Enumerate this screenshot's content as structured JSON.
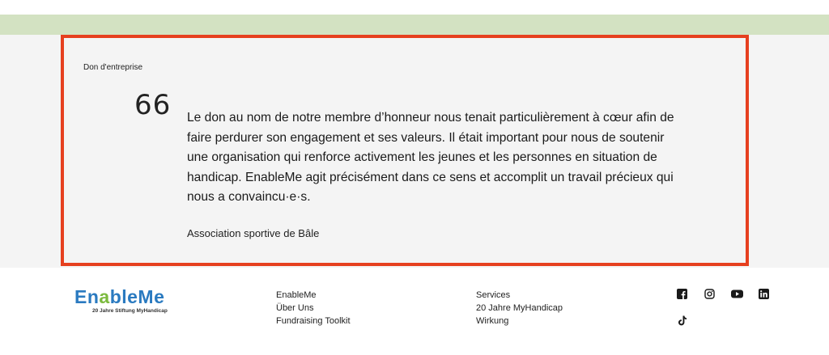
{
  "testimonial": {
    "category": "Don d'entreprise",
    "quote_mark": "66",
    "text": "Le don au nom de notre membre d’honneur nous tenait particulièrement à cœur afin de faire perdurer son engagement et ses valeurs. Il était important pour nous de soutenir une organisation qui renforce activement les jeunes et les personnes en situation de handicap. EnableMe agit précisément dans ce sens et accomplit un travail précieux qui nous a convaincu·e·s.",
    "author": "Association sportive de Bâle"
  },
  "footer": {
    "logo": {
      "name_part1": "En",
      "name_accent": "a",
      "name_part2": "bleMe",
      "tagline": "20 Jahre Stiftung MyHandicap"
    },
    "links_col1": [
      "EnableMe",
      "Über Uns",
      "Fundraising Toolkit"
    ],
    "links_col2": [
      "Services",
      "20 Jahre MyHandicap",
      "Wirkung"
    ],
    "social": [
      "facebook-icon",
      "instagram-icon",
      "youtube-icon",
      "linkedin-icon",
      "tiktok-icon"
    ]
  },
  "colors": {
    "green_bar": "#d3e2c2",
    "highlight_border": "#e6401f",
    "section_bg": "#f4f4f4",
    "logo_blue": "#2a7ac0",
    "logo_green": "#7cba3e"
  }
}
